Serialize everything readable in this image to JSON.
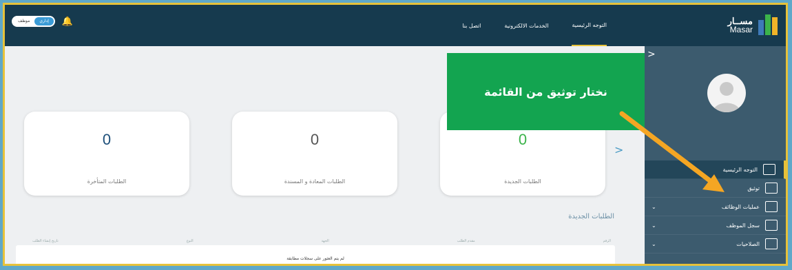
{
  "header": {
    "logo_ar": "مســار",
    "logo_en": "Masar",
    "nav": [
      {
        "label": "التوجه الرئيسية",
        "active": true
      },
      {
        "label": "الخدمات الالكترونية",
        "active": false
      },
      {
        "label": "اتصل بنا",
        "active": false
      }
    ],
    "toggle": {
      "on": "إداري",
      "off": "موظف"
    },
    "bell_icon": "bell-icon"
  },
  "sidebar": {
    "items": [
      {
        "label": "التوجه الرئيسية",
        "icon": "dashboard-icon",
        "active": true,
        "expandable": false
      },
      {
        "label": "توثيق",
        "icon": "document-icon",
        "active": false,
        "expandable": false
      },
      {
        "label": "عمليات الوظائف",
        "icon": "monitor-icon",
        "active": false,
        "expandable": true
      },
      {
        "label": "سجل الموظف",
        "icon": "id-card-icon",
        "active": false,
        "expandable": true
      },
      {
        "label": "الصلاحيات",
        "icon": "monitor-icon",
        "active": false,
        "expandable": true
      }
    ]
  },
  "cards": [
    {
      "value": "0",
      "label": "الطلبات الجديدة",
      "color": "#3bb34a"
    },
    {
      "value": "0",
      "label": "الطلبات المعادة و المسندة",
      "color": "#555555"
    },
    {
      "value": "0",
      "label": "الطلبات المتأخرة",
      "color": "#1d4f7a"
    }
  ],
  "section": {
    "title": "الطلبات الجديدة",
    "columns": [
      "الرقم",
      "مقدم الطلب",
      "الجهة",
      "النوع",
      "تاريخ إنشاء الطلب"
    ],
    "empty_message": "لم يتم العثور على سجلات مطابقة"
  },
  "callout": {
    "text": "نختار توثيق من القائمة",
    "color": "#13a450"
  },
  "colors": {
    "topbar": "#163a4e",
    "sidebar": "#3c5b6e",
    "accent": "#e7c23a",
    "arrow": "#f5a623"
  }
}
